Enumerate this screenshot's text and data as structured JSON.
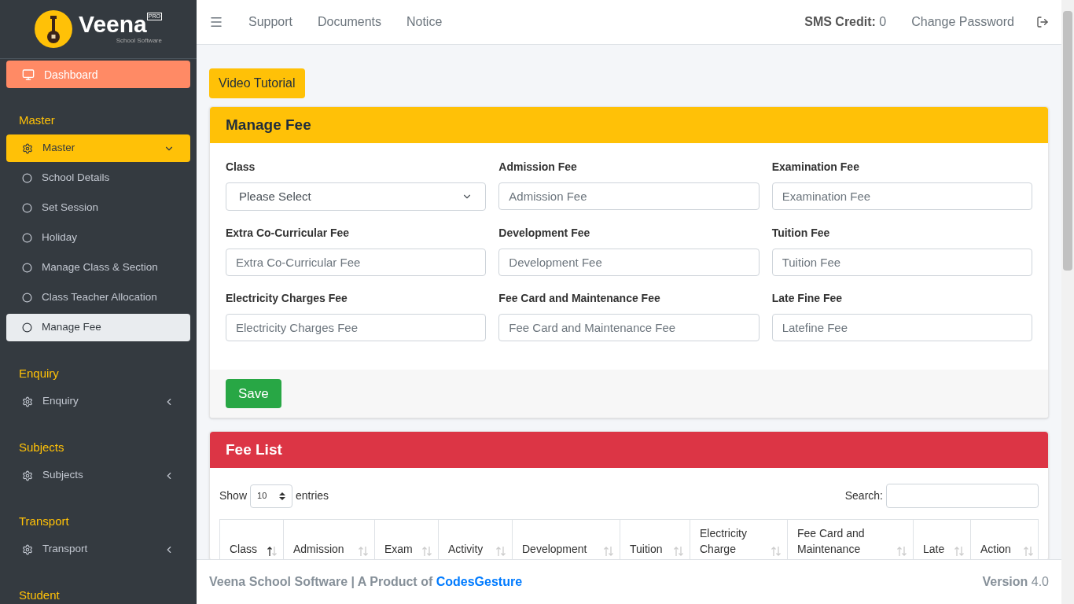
{
  "logo": {
    "name": "Veena",
    "badge": "PRO",
    "tagline": "School Software"
  },
  "sidebar": {
    "dashboard": {
      "label": "Dashboard",
      "selected": true
    },
    "sections": [
      {
        "heading": "Master",
        "group": {
          "label": "Master",
          "expanded": true,
          "children": [
            {
              "label": "School Details",
              "selected": false
            },
            {
              "label": "Set Session",
              "selected": false
            },
            {
              "label": "Holiday",
              "selected": false
            },
            {
              "label": "Manage Class & Section",
              "selected": false
            },
            {
              "label": "Class Teacher Allocation",
              "selected": false
            },
            {
              "label": "Manage Fee",
              "selected": true
            }
          ]
        }
      },
      {
        "heading": "Enquiry",
        "group": {
          "label": "Enquiry",
          "expanded": false
        }
      },
      {
        "heading": "Subjects",
        "group": {
          "label": "Subjects",
          "expanded": false
        }
      },
      {
        "heading": "Transport",
        "group": {
          "label": "Transport",
          "expanded": false
        }
      },
      {
        "heading": "Student"
      }
    ]
  },
  "navbar": {
    "links": [
      "Support",
      "Documents",
      "Notice"
    ],
    "sms_credit": {
      "label": "SMS Credit:",
      "value": "0"
    },
    "change_password": "Change Password"
  },
  "video_tutorial": "Video Tutorial",
  "manage_fee": {
    "title": "Manage Fee",
    "fields": [
      {
        "label": "Class",
        "kind": "select",
        "value": "Please Select"
      },
      {
        "label": "Admission Fee",
        "kind": "input",
        "placeholder": "Admission Fee"
      },
      {
        "label": "Examination Fee",
        "kind": "input",
        "placeholder": "Examination Fee"
      },
      {
        "label": "Extra Co-Curricular Fee",
        "kind": "input",
        "placeholder": "Extra Co-Curricular Fee"
      },
      {
        "label": "Development Fee",
        "kind": "input",
        "placeholder": "Development Fee"
      },
      {
        "label": "Tuition Fee",
        "kind": "input",
        "placeholder": "Tuition Fee"
      },
      {
        "label": "Electricity Charges Fee",
        "kind": "input",
        "placeholder": "Electricity Charges Fee"
      },
      {
        "label": "Fee Card and Maintenance Fee",
        "kind": "input",
        "placeholder": "Fee Card and Maintenance Fee"
      },
      {
        "label": "Late Fine Fee",
        "kind": "input",
        "placeholder": "Latefine Fee"
      }
    ],
    "save": "Save"
  },
  "fee_list": {
    "title": "Fee List",
    "show_label": "Show",
    "page_size": "10",
    "entries_label": "entries",
    "search_label": "Search:",
    "columns": [
      {
        "label": "Class",
        "sorted": true
      },
      {
        "label": "Admission",
        "sorted": false
      },
      {
        "label": "Exam",
        "sorted": false
      },
      {
        "label": "Activity",
        "sorted": false
      },
      {
        "label": "Development",
        "sorted": false
      },
      {
        "label": "Tuition",
        "sorted": false
      },
      {
        "label": "Electricity Charge",
        "sorted": false
      },
      {
        "label": "Fee Card and Maintenance",
        "sorted": false
      },
      {
        "label": "Late",
        "sorted": false
      },
      {
        "label": "Action",
        "sorted": false
      }
    ]
  },
  "footer": {
    "text": "Veena School Software | A Product of",
    "link": "CodesGesture",
    "version_label": "Version",
    "version": "4.0"
  }
}
